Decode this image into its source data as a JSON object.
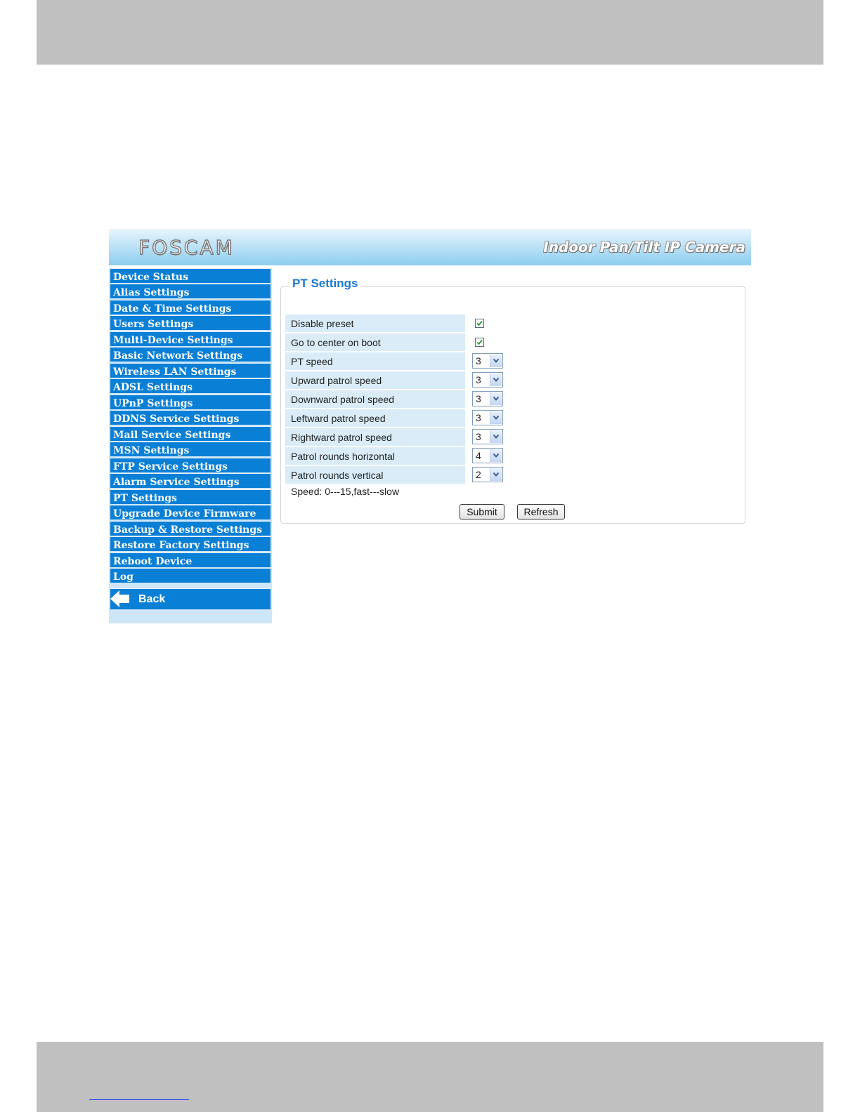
{
  "header": {
    "logo_text": "FOSCAM",
    "product_title": "Indoor Pan/Tilt IP Camera"
  },
  "sidebar": {
    "items": [
      {
        "label": "Device Status"
      },
      {
        "label": "Alias Settings"
      },
      {
        "label": "Date & Time Settings"
      },
      {
        "label": "Users Settings"
      },
      {
        "label": "Multi-Device Settings"
      },
      {
        "label": "Basic Network Settings"
      },
      {
        "label": "Wireless LAN Settings"
      },
      {
        "label": "ADSL Settings"
      },
      {
        "label": "UPnP Settings"
      },
      {
        "label": "DDNS Service Settings"
      },
      {
        "label": "Mail Service Settings"
      },
      {
        "label": "MSN Settings"
      },
      {
        "label": "FTP Service Settings"
      },
      {
        "label": "Alarm Service Settings"
      },
      {
        "label": "PT Settings"
      },
      {
        "label": "Upgrade Device Firmware"
      },
      {
        "label": "Backup & Restore Settings"
      },
      {
        "label": "Restore Factory Settings"
      },
      {
        "label": "Reboot Device"
      },
      {
        "label": "Log"
      }
    ],
    "back_label": "Back"
  },
  "form": {
    "legend": "PT Settings",
    "disable_preset": {
      "label": "Disable preset",
      "checked": true
    },
    "center_on_boot": {
      "label": "Go to center on boot",
      "checked": true
    },
    "pt_speed": {
      "label": "PT speed",
      "value": "3"
    },
    "upward_speed": {
      "label": "Upward patrol speed",
      "value": "3"
    },
    "downward_speed": {
      "label": "Downward patrol speed",
      "value": "3"
    },
    "leftward_speed": {
      "label": "Leftward patrol speed",
      "value": "3"
    },
    "rightward_speed": {
      "label": "Rightward patrol speed",
      "value": "3"
    },
    "rounds_horizontal": {
      "label": "Patrol rounds horizontal",
      "value": "4"
    },
    "rounds_vertical": {
      "label": "Patrol rounds vertical",
      "value": "2"
    },
    "hint": "Speed: 0---15,fast---slow",
    "submit_label": "Submit",
    "refresh_label": "Refresh"
  },
  "colors": {
    "menu_bg": "#0a7fd6",
    "legend": "#1a78d2",
    "row_bg": "#d9ecf8",
    "page_band": "#c0c0c0"
  }
}
